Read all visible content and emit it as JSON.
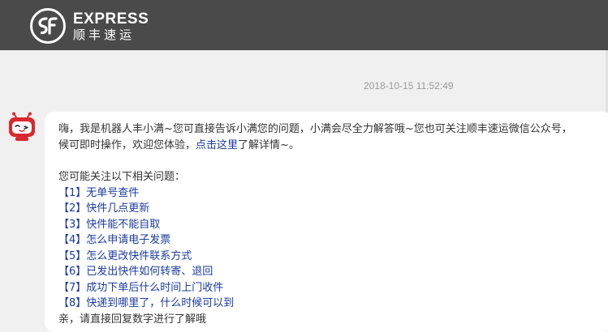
{
  "header": {
    "brand_en": "EXPRESS",
    "brand_cn": "顺丰速运",
    "brand_color": "#4a4a4a",
    "logo_color": "#ffffff"
  },
  "chat": {
    "timestamp": "2018-10-15 11:52:49",
    "bot_avatar_icon": "robot-avatar-icon",
    "message": {
      "intro_line1": "嗨，我是机器人丰小满~您可直接告诉小满您的问题，小满会尽全力解答哦~您也可关注顺丰速运微信公众号，",
      "intro_line2_before": "候可即时操作，欢迎您体验，",
      "intro_link": "点击这里",
      "intro_line2_after": "了解详情~。",
      "questions_title": "您可能关注以下相关问题：",
      "questions": [
        "【1】无单号查件",
        "【2】快件几点更新",
        "【3】快件能不能自取",
        "【4】怎么申请电子发票",
        "【5】怎么更改快件联系方式",
        "【6】已发出快件如何转寄、退回",
        "【7】成功下单后什么时间上门收件",
        "【8】快递到哪里了，什么时候可以到"
      ],
      "closing": "亲，请直接回复数字进行了解哦"
    },
    "link_color": "#1a3b9c",
    "text_color": "#333333"
  }
}
